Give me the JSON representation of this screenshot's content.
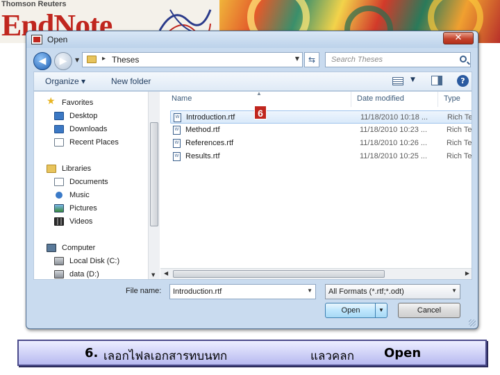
{
  "banner": {
    "brand": "Thomson Reuters",
    "logo_text": "EndNote"
  },
  "dialog": {
    "title": "Open",
    "close_glyph": "✕",
    "address": {
      "path": "Theses"
    },
    "search": {
      "placeholder": "Search Theses"
    },
    "toolbar": {
      "organize": "Organize ▾",
      "new_folder": "New folder"
    },
    "nav": {
      "favorites": {
        "label": "Favorites",
        "items": [
          "Desktop",
          "Downloads",
          "Recent Places"
        ]
      },
      "libraries": {
        "label": "Libraries",
        "items": [
          "Documents",
          "Music",
          "Pictures",
          "Videos"
        ]
      },
      "computer": {
        "label": "Computer",
        "items": [
          "Local Disk (C:)",
          "data (D:)"
        ]
      }
    },
    "columns": {
      "name": "Name",
      "date_modified": "Date modified",
      "type": "Type"
    },
    "files": [
      {
        "name": "Introduction.rtf",
        "date": "11/18/2010 10:18 ...",
        "type": "Rich Te",
        "selected": true
      },
      {
        "name": "Method.rtf",
        "date": "11/18/2010 10:23 ...",
        "type": "Rich Te",
        "selected": false
      },
      {
        "name": "References.rtf",
        "date": "11/18/2010 10:26 ...",
        "type": "Rich Te",
        "selected": false
      },
      {
        "name": "Results.rtf",
        "date": "11/18/2010 10:25 ...",
        "type": "Rich Te",
        "selected": false
      }
    ],
    "step_badge": "6",
    "file_name_label": "File name:",
    "file_name_value": "Introduction.rtf",
    "file_type_value": "All Formats (*.rtf;*.odt)",
    "open_button": "Open",
    "cancel_button": "Cancel"
  },
  "caption": {
    "step": "6.",
    "text_part1": "เลอกไฟลเอกสารทบนทก",
    "text_part2": "แลวคลก",
    "action": "Open"
  },
  "colors": {
    "brand_red": "#c0261e",
    "dialog_frame": "#c9dbef",
    "selection": "#d9e9fa",
    "caption_bg": "#b7b9f0"
  }
}
